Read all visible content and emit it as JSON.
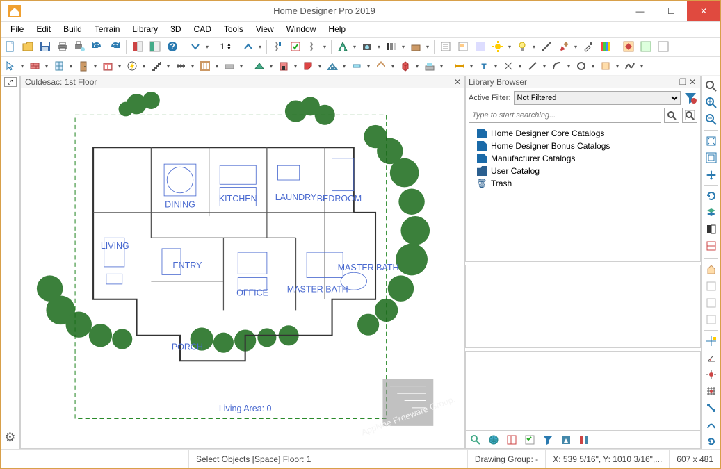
{
  "app": {
    "title": "Home Designer Pro 2019"
  },
  "menu": [
    "File",
    "Edit",
    "Build",
    "Terrain",
    "Library",
    "3D",
    "CAD",
    "Tools",
    "View",
    "Window",
    "Help"
  ],
  "toolbar1_spin": "1",
  "document": {
    "name": "Culdesac:  1st Floor"
  },
  "library": {
    "title": "Library Browser",
    "filter_label": "Active Filter:",
    "filter_value": "Not Filtered",
    "search_placeholder": "Type to start searching...",
    "items": [
      "Home Designer Core Catalogs",
      "Home Designer Bonus Catalogs",
      "Manufacturer Catalogs",
      "User Catalog",
      "Trash"
    ]
  },
  "status": {
    "center": "Select Objects [Space]  Floor: 1",
    "group": "Drawing Group: -",
    "coords": "X: 539 5/16\", Y: 1010 3/16\",...",
    "dims": "607 x 481"
  },
  "colors": {
    "accent": "#d8a04a",
    "close": "#e04a3f",
    "link": "#1a6aa8"
  }
}
